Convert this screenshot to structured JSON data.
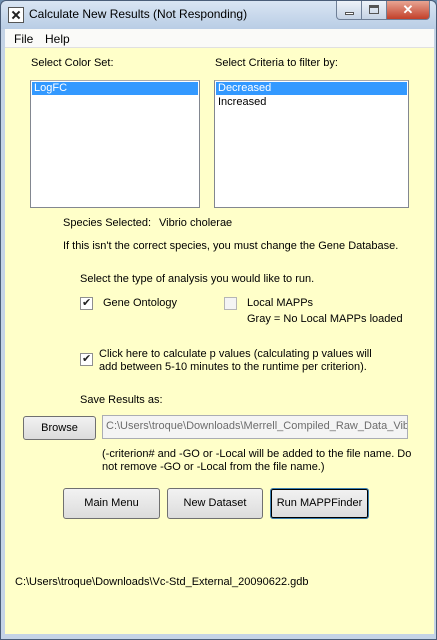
{
  "window": {
    "title": "Calculate New Results (Not Responding)"
  },
  "menu": {
    "file": "File",
    "help": "Help"
  },
  "color_set": {
    "label": "Select Color Set:",
    "items": [
      {
        "label": "LogFC",
        "selected": true
      }
    ]
  },
  "criteria": {
    "label": "Select Criteria to filter by:",
    "items": [
      {
        "label": "Decreased",
        "selected": true
      },
      {
        "label": "Increased",
        "selected": false
      }
    ]
  },
  "species": {
    "label": "Species Selected:",
    "value": "Vibrio cholerae",
    "warning": "If this isn't the correct species, you must change the Gene Database."
  },
  "analysis": {
    "prompt": "Select the type of analysis you would like to run.",
    "gene_ontology": {
      "label": "Gene Ontology",
      "checked": true
    },
    "local_mapps": {
      "label": "Local MAPPs",
      "checked": false
    },
    "local_mapps_note": "Gray = No Local MAPPs loaded"
  },
  "pvalues": {
    "line1": "Click here to calculate p values (calculating p values will",
    "line2": "add between 5-10 minutes to the runtime per criterion).",
    "checked": true
  },
  "save": {
    "label": "Save Results as:",
    "browse_button": "Browse",
    "path": "C:\\Users\\troque\\Downloads\\Merrell_Compiled_Raw_Data_Vib",
    "note_line1": "(-criterion# and -GO or -Local will be added to the file name. Do",
    "note_line2": "not remove -GO or -Local from the file name.)"
  },
  "buttons": {
    "main_menu": "Main Menu",
    "new_dataset": "New Dataset",
    "run": "Run MAPPFinder"
  },
  "status": {
    "database_path": "C:\\Users\\troque\\Downloads\\Vc-Std_External_20090622.gdb"
  }
}
